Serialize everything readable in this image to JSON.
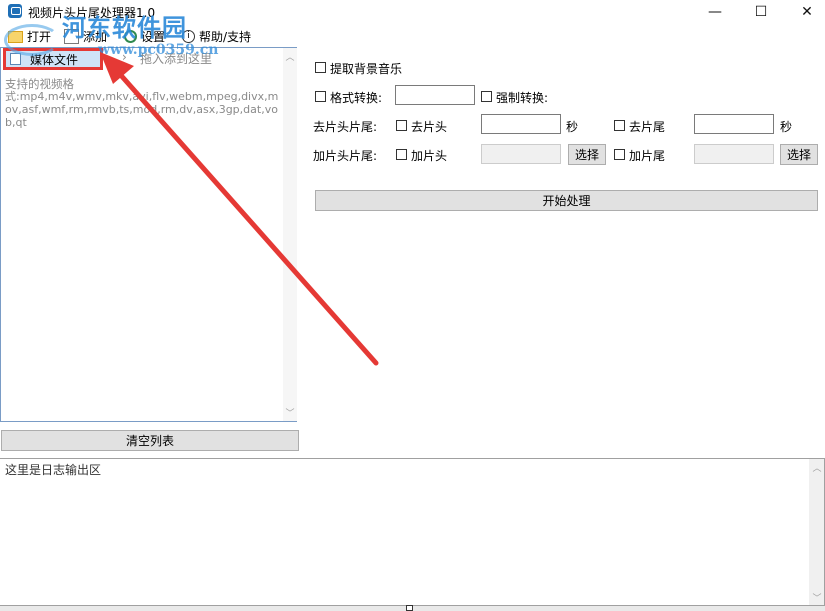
{
  "window": {
    "title": "视频片头片尾处理器1.0",
    "minimize_glyph": "—",
    "maximize_glyph": "☐",
    "close_glyph": "✕"
  },
  "menu": {
    "open": "打开",
    "add": "添加",
    "settings": "设置",
    "help": "帮助/支持"
  },
  "file_list": {
    "media_button": "媒体文件",
    "drag_hint": "拖入添到这里",
    "formats_label": "支持的视频格",
    "formats_text": "式:mp4,m4v,wmv,mkv,avi,flv,webm,mpeg,divx,mov,asf,wmf,rm,rmvb,ts,mod,rm,dv,asx,3gp,dat,vob,qt"
  },
  "clear_button": "清空列表",
  "options": {
    "extract_music": "提取背景音乐",
    "format_convert": "格式转换:",
    "force_convert": "强制转换:",
    "remove_label": "去片头片尾:",
    "remove_head": "去片头",
    "remove_tail": "去片尾",
    "seconds_unit": "秒",
    "add_label": "加片头片尾:",
    "add_head": "加片头",
    "add_tail": "加片尾",
    "browse": "选择"
  },
  "start_button": "开始处理",
  "log_text": "这里是日志输出区",
  "watermark": {
    "logo_text": "河东软件园",
    "url": "www.pc0359.cn"
  },
  "colors": {
    "highlight_border": "#e53935",
    "arrow": "#e53935",
    "watermark": "#2b89d9",
    "list_border": "#7a9cc6"
  }
}
